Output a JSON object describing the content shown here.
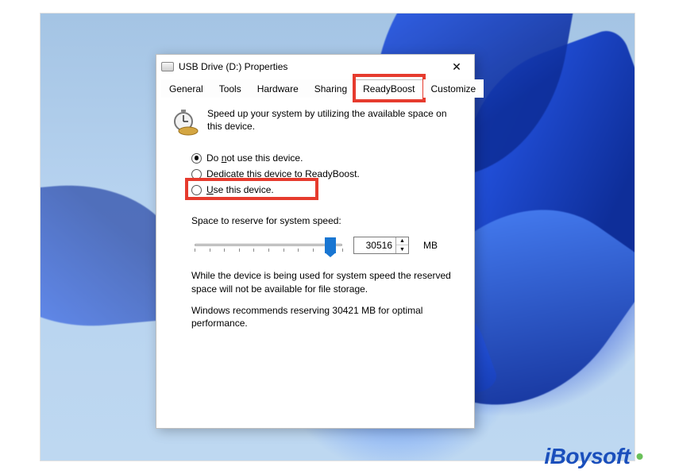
{
  "window": {
    "title": "USB Drive (D:) Properties"
  },
  "tabs": {
    "general": "General",
    "tools": "Tools",
    "hardware": "Hardware",
    "sharing": "Sharing",
    "readyboost": "ReadyBoost",
    "customize": "Customize"
  },
  "intro": "Speed up your system by utilizing the available space on this device.",
  "radios": {
    "do_not_use": "Do not use this device.",
    "dedicate": "Dedicate this device to ReadyBoost.",
    "use": "Use this device."
  },
  "reserve": {
    "label": "Space to reserve for system speed:",
    "value": "30516",
    "unit": "MB"
  },
  "notes": {
    "n1": "While the device is being used for system speed the reserved space will not be available for file storage.",
    "n2": "Windows recommends reserving 30421 MB for optimal performance."
  },
  "watermark": "iBoysoft"
}
